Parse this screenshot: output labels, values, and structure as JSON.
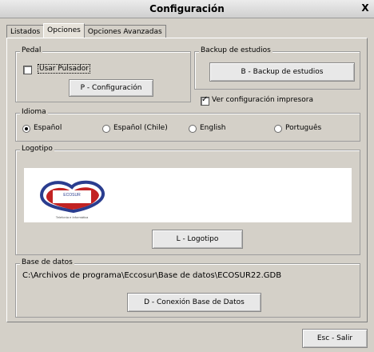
{
  "window": {
    "title": "Configuración",
    "close_label": "X"
  },
  "tabs": [
    {
      "label": "Listados",
      "active": false
    },
    {
      "label": "Opciones",
      "active": true
    },
    {
      "label": "Opciones Avanzadas",
      "active": false
    }
  ],
  "pedal": {
    "legend": "Pedal",
    "checkbox_label": "Usar Pulsador",
    "checkbox_checked": false,
    "button_label": "P - Configuración"
  },
  "backup": {
    "legend": "Backup de estudios",
    "button_label": "B - Backup de estudios",
    "checkbox_label": "Ver configuración impresora",
    "checkbox_checked": true
  },
  "idioma": {
    "legend": "Idioma",
    "options": [
      {
        "label": "Español",
        "selected": true
      },
      {
        "label": "Español (Chile)",
        "selected": false
      },
      {
        "label": "English",
        "selected": false
      },
      {
        "label": "Português",
        "selected": false
      }
    ]
  },
  "logotipo": {
    "legend": "Logotipo",
    "logo_text_top": "ECOSUR",
    "logo_text_sub": "Telefonía e Informática",
    "button_label": "L - Logotipo",
    "colors": {
      "red": "#c22222",
      "blue": "#2a3d8f"
    }
  },
  "base_datos": {
    "legend": "Base de datos",
    "path": "C:\\Archivos de programa\\Eccosur\\Base de datos\\ECOSUR22.GDB",
    "button_label": "D - Conexión Base de Datos"
  },
  "footer": {
    "exit_label": "Esc - Salir"
  }
}
